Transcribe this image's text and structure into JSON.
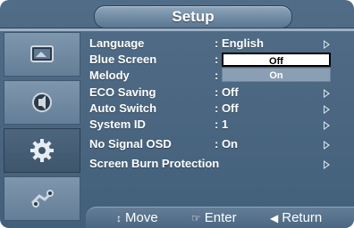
{
  "title": "Setup",
  "menu": {
    "items": [
      {
        "label": "Language",
        "value": ": English",
        "arrow": true
      },
      {
        "label": "Blue Screen",
        "value": ":",
        "arrow": false
      },
      {
        "label": "Melody",
        "value": ":",
        "arrow": false
      },
      {
        "label": "ECO Saving",
        "value": ": Off",
        "arrow": true
      },
      {
        "label": "Auto Switch",
        "value": ": Off",
        "arrow": true
      },
      {
        "label": "System ID",
        "value": ": 1",
        "arrow": true
      },
      {
        "label": "No Signal OSD",
        "value": ": On",
        "arrow": true
      },
      {
        "label": "Screen Burn Protection",
        "value": "",
        "arrow": true
      }
    ],
    "dropdown": {
      "options": [
        "Off",
        "On"
      ],
      "selected": "Off"
    }
  },
  "sidebar": {
    "tiles": [
      "picture-icon",
      "sound-icon",
      "setup-gear-icon",
      "input-icon"
    ],
    "active": "setup-gear-icon"
  },
  "footer": {
    "move": "Move",
    "enter": "Enter",
    "return": "Return"
  },
  "colors": {
    "background": "#4a6680",
    "title_bar": "#6f8aa3",
    "selected_option": "#ffffff",
    "other_option": "#8a9fb3"
  }
}
